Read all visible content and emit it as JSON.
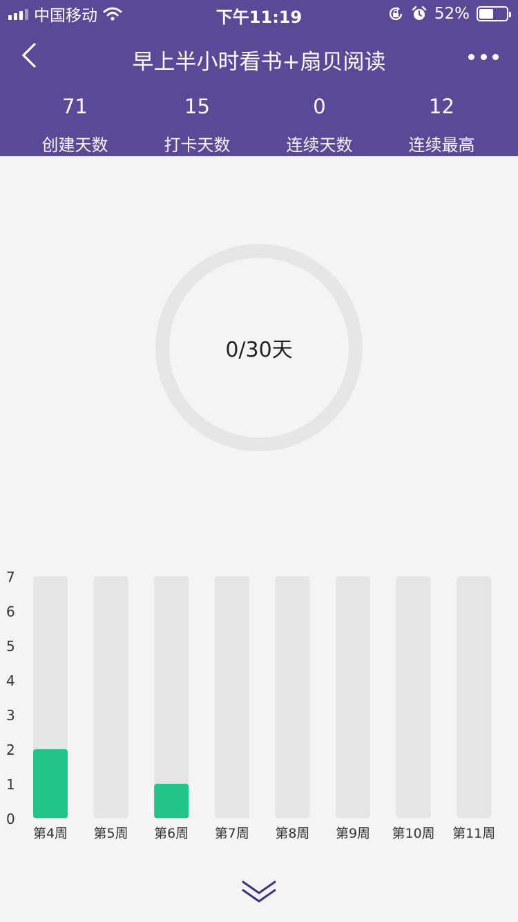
{
  "status_bar": {
    "carrier": "中国移动",
    "time": "下午11:19",
    "battery_percent": "52%",
    "battery_level": 0.52,
    "icons": [
      "signal-icon",
      "wifi-icon",
      "rotation-lock-icon",
      "alarm-icon",
      "battery-icon"
    ]
  },
  "header": {
    "title": "早上半小时看书+扇贝阅读",
    "back_icon": "chevron-left-icon",
    "more_icon": "more-dots-icon",
    "background": "#5b4897",
    "stats": [
      {
        "value": "71",
        "label": "创建天数"
      },
      {
        "value": "15",
        "label": "打卡天数"
      },
      {
        "value": "0",
        "label": "连续天数"
      },
      {
        "value": "12",
        "label": "连续最高"
      }
    ]
  },
  "progress": {
    "text": "0/30天",
    "current": 0,
    "total": 30
  },
  "chart_data": {
    "type": "bar",
    "categories": [
      "第4周",
      "第5周",
      "第6周",
      "第7周",
      "第8周",
      "第9周",
      "第10周",
      "第11周"
    ],
    "values": [
      2,
      0,
      1,
      0,
      0,
      0,
      0,
      0
    ],
    "ylim": [
      0,
      7
    ],
    "yticks": [
      "0",
      "1",
      "2",
      "3",
      "4",
      "5",
      "6",
      "7"
    ],
    "bar_color": "#21c587",
    "track_color": "#e5e5e5",
    "grid": false
  },
  "footer": {
    "expand_icon": "chevron-double-down-icon"
  }
}
